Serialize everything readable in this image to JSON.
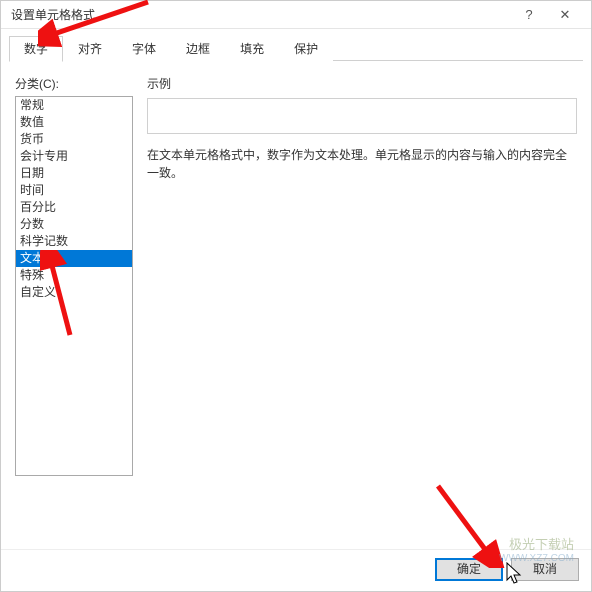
{
  "dialog": {
    "title": "设置单元格格式",
    "help_icon": "?",
    "close_icon": "✕"
  },
  "tabs": {
    "items": [
      "数字",
      "对齐",
      "字体",
      "边框",
      "填充",
      "保护"
    ],
    "active_index": 0
  },
  "category": {
    "label": "分类(C):",
    "items": [
      "常规",
      "数值",
      "货币",
      "会计专用",
      "日期",
      "时间",
      "百分比",
      "分数",
      "科学记数",
      "文本",
      "特殊",
      "自定义"
    ],
    "selected_index": 9
  },
  "sample": {
    "label": "示例",
    "value": ""
  },
  "description": "在文本单元格格式中，数字作为文本处理。单元格显示的内容与输入的内容完全一致。",
  "footer": {
    "ok": "确定",
    "cancel": "取消"
  },
  "watermark": {
    "line1": "极光下载站",
    "line2": "WWW.XZ7.COM"
  }
}
